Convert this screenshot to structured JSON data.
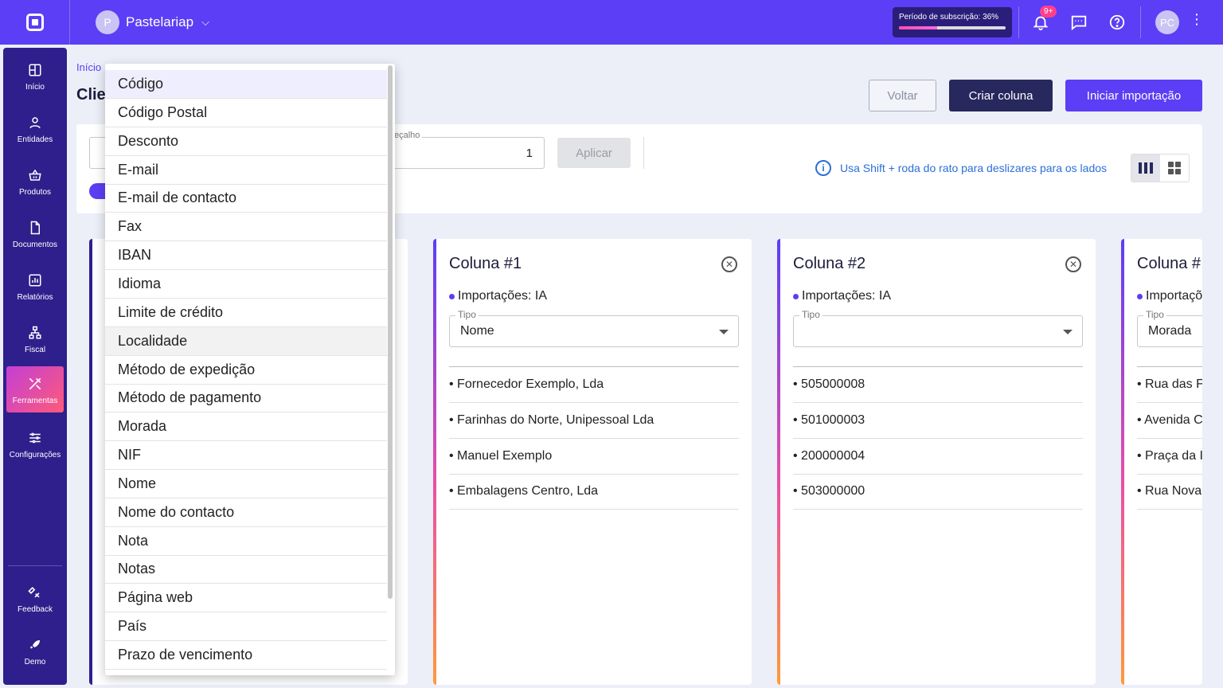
{
  "topbar": {
    "company_initial": "P",
    "company_name": "Pastelariap",
    "subscription_label": "Período de subscrição: 36%",
    "subscription_progress": 0.36,
    "notifications_badge": "9+",
    "user_initials": "PC"
  },
  "sidebar": {
    "items": [
      {
        "label": "Início",
        "icon": "grid-icon"
      },
      {
        "label": "Entidades",
        "icon": "user-icon"
      },
      {
        "label": "Produtos",
        "icon": "basket-icon"
      },
      {
        "label": "Documentos",
        "icon": "document-icon"
      },
      {
        "label": "Relatórios",
        "icon": "chart-icon"
      },
      {
        "label": "Fiscal",
        "icon": "hierarchy-icon"
      },
      {
        "label": "Ferramentas",
        "icon": "tools-icon"
      },
      {
        "label": "Configurações",
        "icon": "sliders-icon"
      }
    ],
    "bottom": [
      {
        "label": "Feedback",
        "icon": "feedback-icon"
      },
      {
        "label": "Demo",
        "icon": "rocket-icon"
      }
    ]
  },
  "page": {
    "breadcrumb_start": "Início",
    "title_start": "Clie",
    "buttons": {
      "back": "Voltar",
      "create_column": "Criar coluna",
      "start_import": "Iniciar importação"
    }
  },
  "filters": {
    "header_field_label": "eçalho",
    "header_field_value": "1",
    "apply": "Aplicar",
    "hint": "Usa Shift + roda do rato para deslizares para os lados"
  },
  "columns": [
    {
      "title": "Coluna #1",
      "import_label": "Importações: IA",
      "type_label": "Tipo",
      "type_value": "Nome",
      "rows": [
        "• Fornecedor Exemplo, Lda",
        "• Farinhas do Norte, Unipessoal Lda",
        "• Manuel Exemplo",
        "• Embalagens Centro, Lda"
      ]
    },
    {
      "title": "Coluna #2",
      "import_label": "Importações: IA",
      "type_label": "Tipo",
      "type_value": "",
      "rows": [
        "• 505000008",
        "• 501000003",
        "• 200000004",
        "• 503000000"
      ]
    },
    {
      "title": "Coluna #",
      "import_label": "Importaçõ",
      "type_label": "Tipo",
      "type_value": "Morada",
      "rows": [
        "• Rua das F",
        "• Avenida C",
        "• Praça da I",
        "• Rua Nova"
      ]
    }
  ],
  "dropdown": {
    "options": [
      "Código",
      "Código Postal",
      "Desconto",
      "E-mail",
      "E-mail de contacto",
      "Fax",
      "IBAN",
      "Idioma",
      "Limite de crédito",
      "Localidade",
      "Método de expedição",
      "Método de pagamento",
      "Morada",
      "NIF",
      "Nome",
      "Nome do contacto",
      "Nota",
      "Notas",
      "Página web",
      "País",
      "Prazo de vencimento"
    ],
    "hovered": "Localidade"
  }
}
